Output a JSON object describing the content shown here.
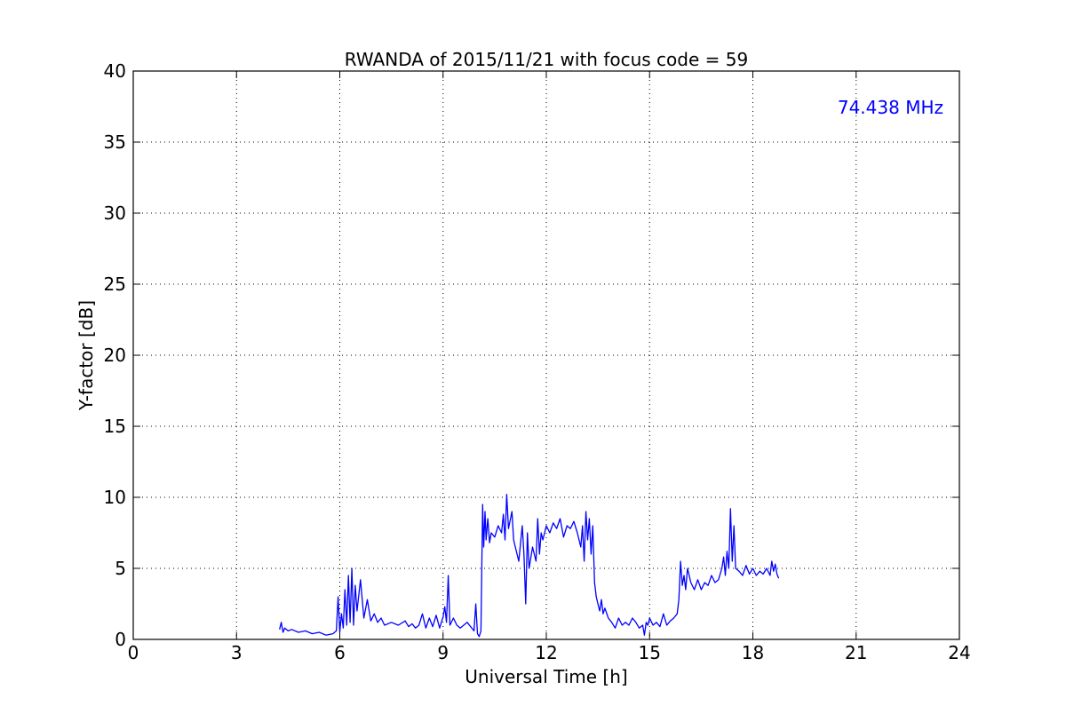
{
  "chart_data": {
    "type": "line",
    "title": "RWANDA of 2015/11/21 with focus code = 59",
    "xlabel": "Universal Time [h]",
    "ylabel": "Y-factor [dB]",
    "xlim": [
      0,
      24
    ],
    "ylim": [
      0,
      40
    ],
    "xticks": [
      0,
      3,
      6,
      9,
      12,
      15,
      18,
      21,
      24
    ],
    "yticks": [
      0,
      5,
      10,
      15,
      20,
      25,
      30,
      35,
      40
    ],
    "xtick_labels": [
      "0",
      "3",
      "6",
      "9",
      "12",
      "15",
      "18",
      "21",
      "24"
    ],
    "ytick_labels": [
      "0",
      "5",
      "10",
      "15",
      "20",
      "25",
      "30",
      "35",
      "40"
    ],
    "grid": true,
    "annotation": {
      "text": "74.438 MHz",
      "color": "#0000ff",
      "placement": "top-right"
    },
    "series": [
      {
        "color": "#0000ff",
        "x": [
          4.25,
          4.3,
          4.35,
          4.4,
          4.5,
          4.6,
          4.8,
          5.0,
          5.2,
          5.4,
          5.6,
          5.8,
          5.9,
          5.95,
          6.0,
          6.05,
          6.1,
          6.15,
          6.2,
          6.25,
          6.3,
          6.35,
          6.4,
          6.45,
          6.5,
          6.6,
          6.7,
          6.8,
          6.9,
          7.0,
          7.1,
          7.2,
          7.3,
          7.5,
          7.7,
          7.9,
          8.0,
          8.1,
          8.2,
          8.3,
          8.4,
          8.5,
          8.6,
          8.7,
          8.8,
          8.9,
          9.0,
          9.05,
          9.1,
          9.15,
          9.2,
          9.3,
          9.4,
          9.5,
          9.7,
          9.9,
          9.95,
          10.0,
          10.05,
          10.1,
          10.15,
          10.18,
          10.22,
          10.25,
          10.3,
          10.35,
          10.4,
          10.5,
          10.6,
          10.7,
          10.75,
          10.8,
          10.85,
          10.9,
          11.0,
          11.05,
          11.1,
          11.2,
          11.3,
          11.35,
          11.4,
          11.45,
          11.5,
          11.6,
          11.7,
          11.75,
          11.8,
          11.85,
          11.9,
          12.0,
          12.1,
          12.2,
          12.3,
          12.4,
          12.5,
          12.6,
          12.7,
          12.8,
          12.9,
          13.0,
          13.05,
          13.1,
          13.15,
          13.2,
          13.25,
          13.3,
          13.35,
          13.4,
          13.45,
          13.5,
          13.55,
          13.6,
          13.65,
          13.7,
          13.8,
          13.9,
          14.0,
          14.1,
          14.2,
          14.3,
          14.4,
          14.5,
          14.6,
          14.7,
          14.8,
          14.85,
          14.9,
          14.95,
          15.0,
          15.1,
          15.2,
          15.3,
          15.4,
          15.5,
          15.6,
          15.7,
          15.8,
          15.85,
          15.9,
          15.95,
          16.0,
          16.05,
          16.1,
          16.2,
          16.3,
          16.4,
          16.5,
          16.6,
          16.7,
          16.8,
          16.9,
          17.0,
          17.1,
          17.15,
          17.2,
          17.25,
          17.3,
          17.35,
          17.4,
          17.45,
          17.5,
          17.6,
          17.7,
          17.8,
          17.9,
          18.0,
          18.1,
          18.2,
          18.3,
          18.4,
          18.5,
          18.55,
          18.6,
          18.65,
          18.7,
          18.75
        ],
        "y": [
          0.7,
          1.2,
          0.5,
          0.8,
          0.6,
          0.7,
          0.5,
          0.6,
          0.4,
          0.5,
          0.3,
          0.4,
          0.6,
          3.0,
          0.5,
          1.8,
          0.8,
          3.5,
          1.0,
          4.5,
          1.2,
          5.0,
          1.0,
          3.8,
          2.0,
          4.2,
          1.5,
          2.8,
          1.3,
          1.8,
          1.2,
          1.5,
          1.0,
          1.2,
          1.0,
          1.3,
          0.9,
          1.1,
          0.8,
          1.0,
          1.8,
          0.8,
          1.5,
          0.9,
          1.7,
          0.8,
          1.6,
          2.3,
          1.2,
          4.5,
          1.0,
          1.5,
          1.0,
          0.8,
          1.2,
          0.6,
          2.5,
          0.4,
          0.2,
          0.6,
          9.5,
          6.5,
          9.0,
          7.0,
          8.5,
          6.8,
          7.5,
          7.2,
          8.0,
          7.5,
          8.8,
          7.0,
          10.2,
          7.8,
          9.0,
          7.0,
          6.5,
          5.5,
          8.0,
          6.0,
          2.5,
          7.5,
          5.0,
          6.5,
          5.5,
          8.5,
          6.0,
          7.5,
          7.0,
          8.0,
          7.5,
          8.2,
          7.8,
          8.5,
          7.2,
          8.0,
          7.8,
          8.3,
          7.5,
          6.5,
          8.0,
          5.5,
          9.0,
          7.0,
          8.5,
          6.0,
          8.0,
          4.0,
          3.0,
          2.5,
          2.0,
          2.8,
          1.8,
          2.2,
          1.5,
          1.2,
          0.8,
          1.5,
          1.0,
          1.2,
          1.0,
          1.5,
          1.2,
          0.8,
          1.0,
          0.3,
          1.2,
          1.0,
          1.5,
          1.0,
          1.2,
          0.9,
          1.8,
          1.0,
          1.3,
          1.5,
          1.8,
          2.8,
          5.5,
          3.8,
          4.5,
          3.5,
          5.0,
          4.0,
          3.5,
          4.2,
          3.5,
          4.0,
          3.8,
          4.5,
          4.0,
          4.2,
          5.0,
          5.8,
          4.5,
          6.2,
          5.0,
          9.2,
          5.5,
          8.0,
          5.0,
          4.8,
          4.5,
          5.2,
          4.6,
          5.0,
          4.5,
          4.8,
          4.6,
          5.0,
          4.5,
          5.5,
          4.8,
          5.3,
          4.6,
          4.3
        ]
      }
    ]
  }
}
